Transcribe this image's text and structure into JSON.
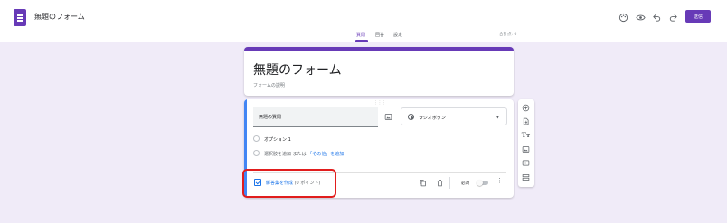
{
  "header": {
    "title": "無題のフォーム",
    "send_label": "送信",
    "icons": [
      "palette-icon",
      "preview-eye-icon",
      "undo-icon",
      "redo-icon"
    ]
  },
  "tabs": [
    {
      "label": "質問",
      "active": true
    },
    {
      "label": "回答",
      "active": false
    },
    {
      "label": "設定",
      "active": false
    }
  ],
  "total_points": "合計点: 0",
  "form": {
    "title": "無題のフォーム",
    "description_placeholder": "フォームの説明"
  },
  "question": {
    "title": "無題の質問",
    "type": "ラジオボタン",
    "options": [
      "オプション 1"
    ],
    "add_option": "選択肢を追加",
    "or": "または",
    "add_other": "「その他」を追加",
    "answer_key_label": "解答集を作成",
    "points": "(0 ポイント)",
    "required_label": "必須",
    "required": false
  },
  "side_toolbar": [
    "add-question",
    "import-questions",
    "add-title-description",
    "add-image",
    "add-video",
    "add-section"
  ],
  "colors": {
    "accent": "#673ab7",
    "link": "#1a73e8",
    "canvas": "#f0ebf8",
    "highlight": "#e11d1d"
  }
}
